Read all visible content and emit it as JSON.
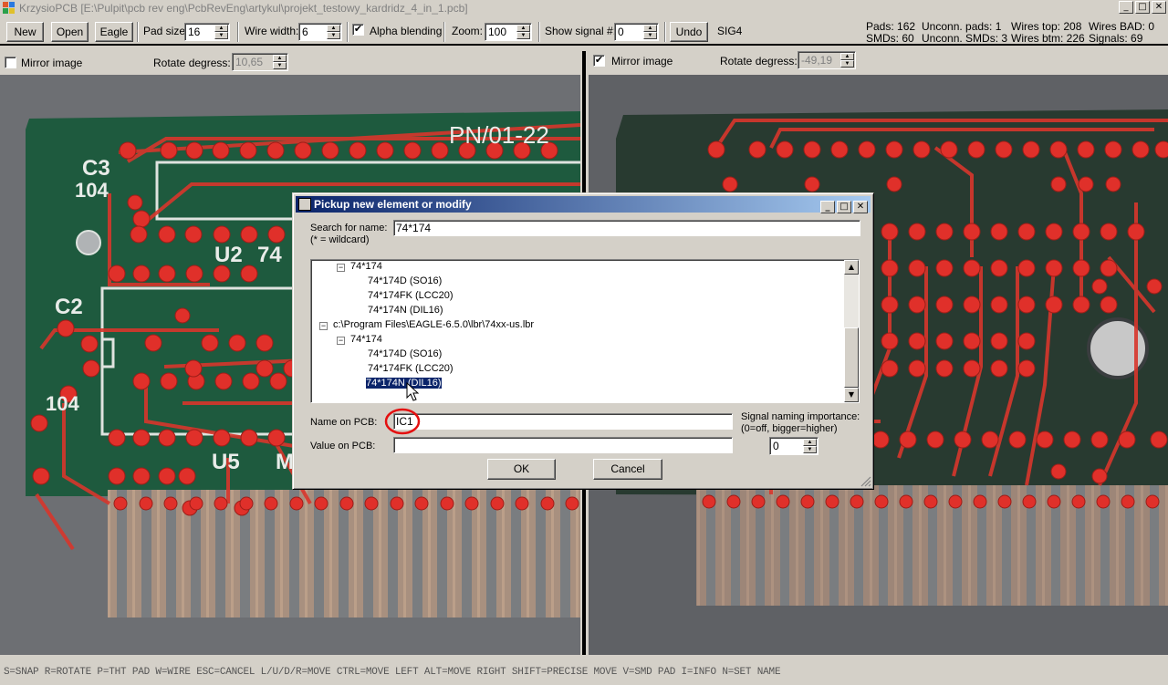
{
  "window": {
    "title": "KrzysioPCB [E:\\Pulpit\\pcb rev eng\\PcbRevEng\\artykul\\projekt_testowy_kardridz_4_in_1.pcb]",
    "controls": [
      "_",
      "□",
      "✕"
    ]
  },
  "toolbar": {
    "new_label": "New",
    "open_label": "Open",
    "eagle_label": "Eagle",
    "pad_size_label": "Pad size:",
    "pad_size_value": "16",
    "wire_width_label": "Wire width:",
    "wire_width_value": "6",
    "alpha_blending_label": "Alpha blending",
    "alpha_blending_checked": true,
    "zoom_label": "Zoom:",
    "zoom_value": "100",
    "show_signal_label": "Show signal #:",
    "show_signal_value": "0",
    "undo_label": "Undo",
    "signal_name": "SIG4"
  },
  "stats": {
    "pads": "Pads: 162",
    "smds": "SMDs: 60",
    "unconn_pads": "Unconn. pads: 1",
    "unconn_smds": "Unconn. SMDs: 3",
    "wires_top": "Wires top: 208",
    "wires_btm": "Wires btm: 226",
    "wires_bad": "Wires BAD: 0",
    "signals": "Signals: 69"
  },
  "left_view": {
    "mirror_label": "Mirror image",
    "mirror_checked": false,
    "rotate_label": "Rotate degress:",
    "rotate_value": "10,65",
    "silkscreen": [
      "C3",
      "104",
      "C2",
      "104",
      "U2",
      "74",
      "U5",
      "M",
      "PN/01-22"
    ]
  },
  "right_view": {
    "mirror_label": "Mirror image",
    "mirror_checked": true,
    "rotate_label": "Rotate degress:",
    "rotate_value": "-49,19"
  },
  "dialog": {
    "title": "Pickup new element or modify",
    "search_label": "Search for name:",
    "search_hint": "(* =  wildcard)",
    "search_value": "74*174",
    "tree": [
      {
        "level": 1,
        "text": "74*174",
        "expander": "−"
      },
      {
        "level": 2,
        "text": "74*174D (SO16)"
      },
      {
        "level": 2,
        "text": "74*174FK (LCC20)"
      },
      {
        "level": 2,
        "text": "74*174N (DIL16)"
      },
      {
        "level": 0,
        "text": "c:\\Program Files\\EAGLE-6.5.0\\lbr\\74xx-us.lbr",
        "expander": "−"
      },
      {
        "level": 1,
        "text": "74*174",
        "expander": "−"
      },
      {
        "level": 2,
        "text": "74*174D (SO16)"
      },
      {
        "level": 2,
        "text": "74*174FK (LCC20)"
      },
      {
        "level": 2,
        "text": "74*174N (DIL16)",
        "selected": true
      }
    ],
    "name_label": "Name on PCB:",
    "name_value": "IC1",
    "value_label": "Value on PCB:",
    "value_value": "",
    "importance_label_1": "Signal naming importance:",
    "importance_label_2": "(0=off, bigger=higher)",
    "importance_value": "0",
    "ok_label": "OK",
    "cancel_label": "Cancel"
  },
  "statusbar": {
    "text": "S=SNAP  R=ROTATE  P=THT PAD  W=WIRE  ESC=CANCEL  L/U/D/R=MOVE  CTRL=MOVE LEFT  ALT=MOVE RIGHT  SHIFT=PRECISE MOVE  V=SMD PAD  I=INFO  N=SET NAME"
  },
  "colors": {
    "pcb_green": "#1f5a3c",
    "trace_red": "#d8362c",
    "pad_red": "#e0302a",
    "gold": "#a88a7a",
    "selection": "#0a246a"
  }
}
